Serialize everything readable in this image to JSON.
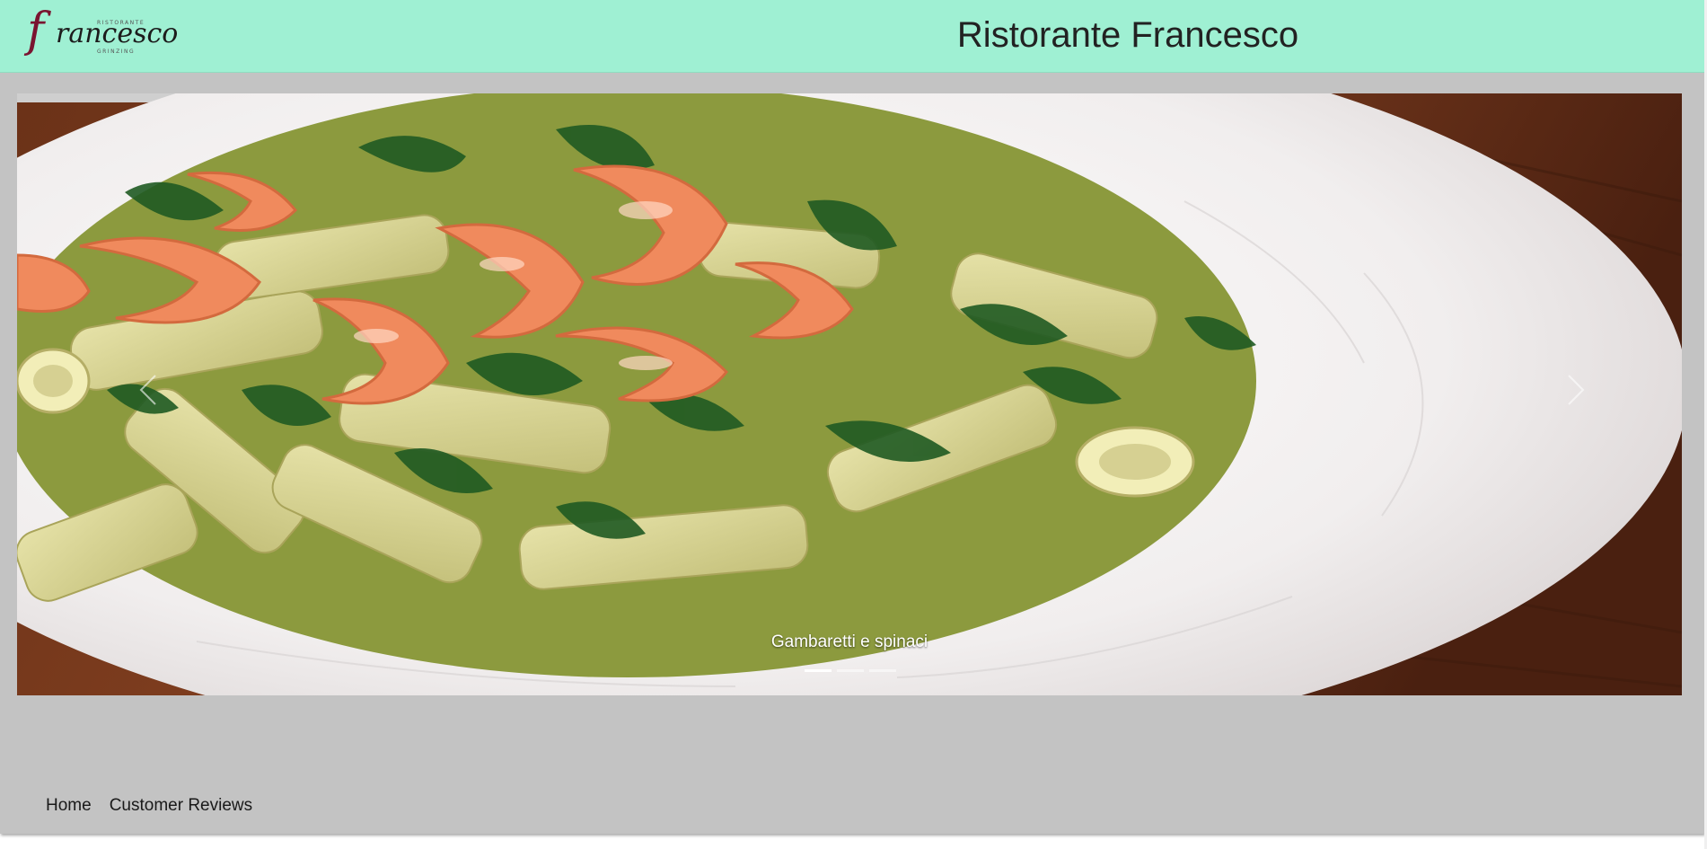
{
  "header": {
    "logo": {
      "top_text": "RISTORANTE",
      "script_text": "rancesco",
      "bottom_text": "GRINZING",
      "mark": "f"
    },
    "title": "Ristorante Francesco"
  },
  "carousel": {
    "slide": {
      "caption": "Gambaretti e spinaci",
      "image_subject": "penne pasta with shrimp and spinach on white plate"
    },
    "indicators": [
      true,
      false,
      false
    ],
    "prev_icon": "chevron-left-icon",
    "next_icon": "chevron-right-icon"
  },
  "nav": {
    "items": [
      {
        "label": "Home"
      },
      {
        "label": "Customer Reviews"
      }
    ]
  },
  "colors": {
    "header_bg": "#9ff0d3",
    "page_bg": "#c3c3c3",
    "logo_accent": "#7a1430"
  }
}
